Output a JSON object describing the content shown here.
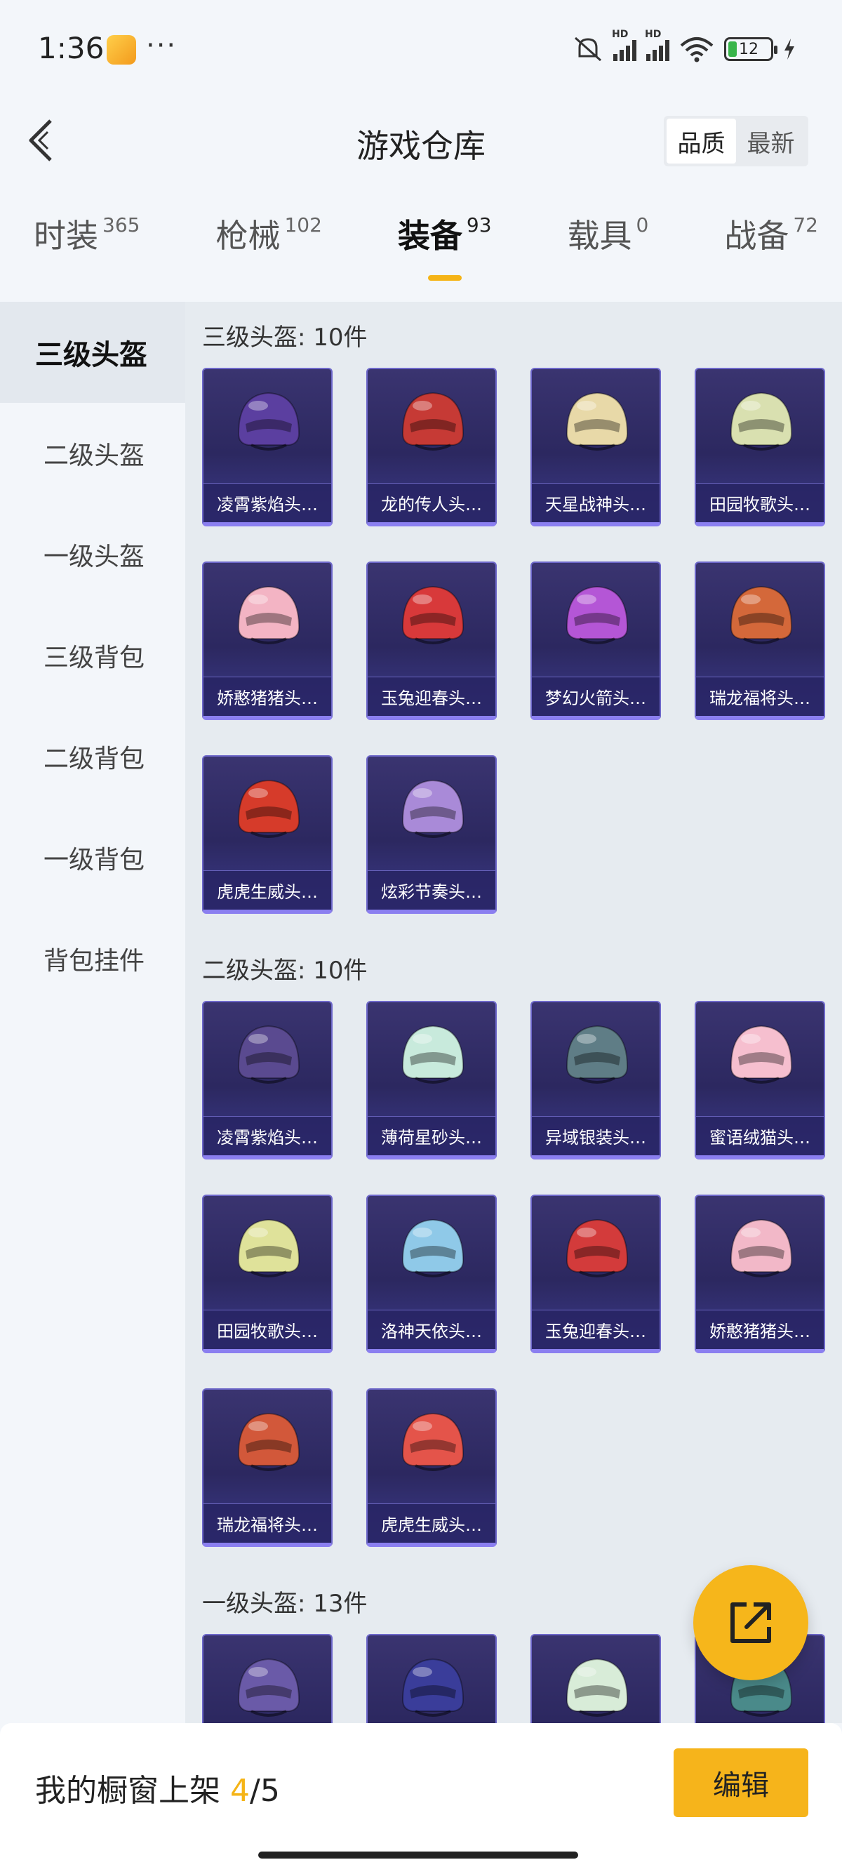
{
  "status": {
    "time": "1:36",
    "dots": "···",
    "battery": "12"
  },
  "header": {
    "title": "游戏仓库",
    "sort_options": [
      "品质",
      "最新"
    ],
    "sort_active": "品质"
  },
  "tabs": [
    {
      "label": "时装",
      "count": "365"
    },
    {
      "label": "枪械",
      "count": "102"
    },
    {
      "label": "装备",
      "count": "93",
      "active": true
    },
    {
      "label": "载具",
      "count": "0"
    },
    {
      "label": "战备",
      "count": "72"
    }
  ],
  "categories": [
    "三级头盔",
    "二级头盔",
    "一级头盔",
    "三级背包",
    "二级背包",
    "一级背包",
    "背包挂件"
  ],
  "active_category": "三级头盔",
  "sections": [
    {
      "title": "三级头盔: 10件",
      "items": [
        {
          "name": "凌霄紫焰头…",
          "color": "#5b3fa0"
        },
        {
          "name": "龙的传人头…",
          "color": "#c63a35"
        },
        {
          "name": "天星战神头…",
          "color": "#e8d9a8"
        },
        {
          "name": "田园牧歌头…",
          "color": "#d9e0b0"
        },
        {
          "name": "娇憨猪猪头…",
          "color": "#f3b4c4"
        },
        {
          "name": "玉兔迎春头…",
          "color": "#d8393a"
        },
        {
          "name": "梦幻火箭头…",
          "color": "#b456d6"
        },
        {
          "name": "瑞龙福将头…",
          "color": "#d4683a"
        },
        {
          "name": "虎虎生威头…",
          "color": "#d63b2a"
        },
        {
          "name": "炫彩节奏头…",
          "color": "#a98ad8"
        }
      ]
    },
    {
      "title": "二级头盔: 10件",
      "items": [
        {
          "name": "凌霄紫焰头…",
          "color": "#5a4a90"
        },
        {
          "name": "薄荷星砂头…",
          "color": "#c8eadc"
        },
        {
          "name": "异域银装头…",
          "color": "#5f7d86"
        },
        {
          "name": "蜜语绒猫头…",
          "color": "#f6bfcf"
        },
        {
          "name": "田园牧歌头…",
          "color": "#dfe29a"
        },
        {
          "name": "洛神天依头…",
          "color": "#8fc9e8"
        },
        {
          "name": "玉兔迎春头…",
          "color": "#d33b3b"
        },
        {
          "name": "娇憨猪猪头…",
          "color": "#f2b8c8"
        },
        {
          "name": "瑞龙福将头…",
          "color": "#d2583a"
        },
        {
          "name": "虎虎生威头…",
          "color": "#e4544a"
        }
      ]
    },
    {
      "title": "一级头盔: 13件",
      "items": [
        {
          "name": "",
          "color": "#6a5aa8"
        },
        {
          "name": "",
          "color": "#3a3d9a"
        },
        {
          "name": "",
          "color": "#d8ecd8"
        },
        {
          "name": "",
          "color": "#4a8a8a"
        }
      ]
    }
  ],
  "bottom": {
    "showcase_label": "我的橱窗上架",
    "showcase_current": "4",
    "showcase_sep": "/",
    "showcase_total": "5",
    "edit_label": "编辑"
  }
}
